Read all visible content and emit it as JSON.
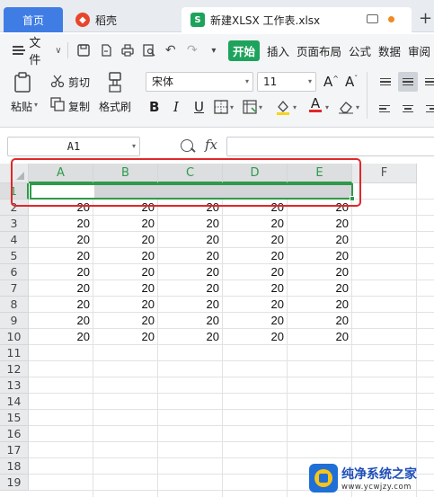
{
  "tabs": {
    "home": "首页",
    "daoke": "稻壳",
    "file": "新建XLSX 工作表.xlsx",
    "new_tab": "+"
  },
  "menu": {
    "file": "文件",
    "items": [
      "开始",
      "插入",
      "页面布局",
      "公式",
      "数据",
      "审阅"
    ],
    "active": "开始",
    "active_color": "#1ea35c"
  },
  "ribbon": {
    "paste": "粘贴",
    "cut": "剪切",
    "copy": "复制",
    "format_painter": "格式刷",
    "font_name": "宋体",
    "font_size": "11",
    "bold": "B",
    "italic": "I",
    "underline": "U",
    "font_color": "A"
  },
  "formula_bar": {
    "name_box": "A1",
    "fx": "fx",
    "formula_value": ""
  },
  "sheet": {
    "columns": [
      "A",
      "B",
      "C",
      "D",
      "E",
      "F"
    ],
    "rows": [
      "1",
      "2",
      "3",
      "4",
      "5",
      "6",
      "7",
      "8",
      "9",
      "10",
      "11",
      "12",
      "13",
      "14",
      "15",
      "16",
      "17",
      "18",
      "19"
    ],
    "cell_value": "20",
    "data_rows": [
      "2",
      "3",
      "4",
      "5",
      "6",
      "7",
      "8",
      "9",
      "10"
    ],
    "data_cols": [
      "A",
      "B",
      "C",
      "D",
      "E"
    ],
    "selected_range": "A1:E1",
    "selection_color": "#2f9a4a",
    "annotation_color": "#e0272a"
  },
  "watermark": {
    "title": "纯净系统之家",
    "url": "www.ycwjzy.com"
  }
}
